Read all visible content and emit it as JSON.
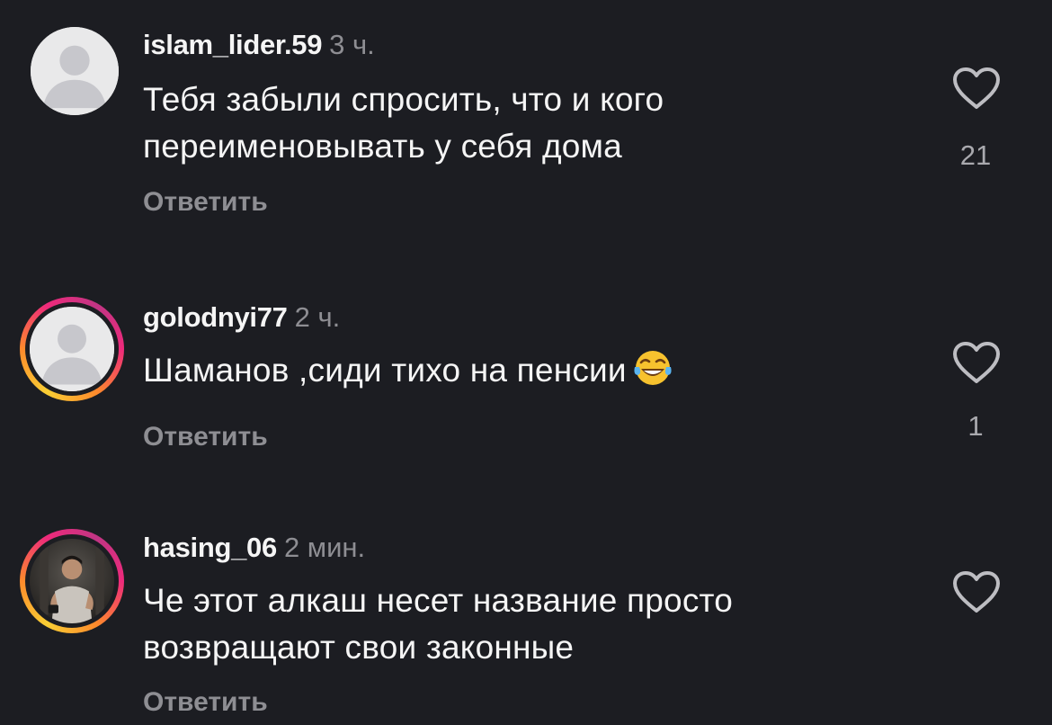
{
  "comments": [
    {
      "username": "islam_lider.59",
      "time": "3 ч.",
      "text": "Тебя забыли спросить, что и кого переименовывать у себя дома",
      "reply_label": "Ответить",
      "likes": "21",
      "avatar": "default-avatar",
      "story_ring": false
    },
    {
      "username": "golodnyi77",
      "time": "2 ч.",
      "text": "Шаманов ,сиди тихо на пенсии",
      "emoji": "face-with-tears-of-joy",
      "reply_label": "Ответить",
      "likes": "1",
      "avatar": "default-avatar",
      "story_ring": true
    },
    {
      "username": "hasing_06",
      "time": "2 мин.",
      "text": "Че этот алкаш несет название просто возвращают свои законные",
      "reply_label": "Ответить",
      "likes": "",
      "avatar": "photo-avatar",
      "story_ring": true
    }
  ],
  "colors": {
    "background": "#1c1d22",
    "text": "#f5f5f5",
    "secondary": "#8e8e93",
    "ring": [
      "#f9ce34",
      "#ee2a7b",
      "#c13584"
    ]
  }
}
